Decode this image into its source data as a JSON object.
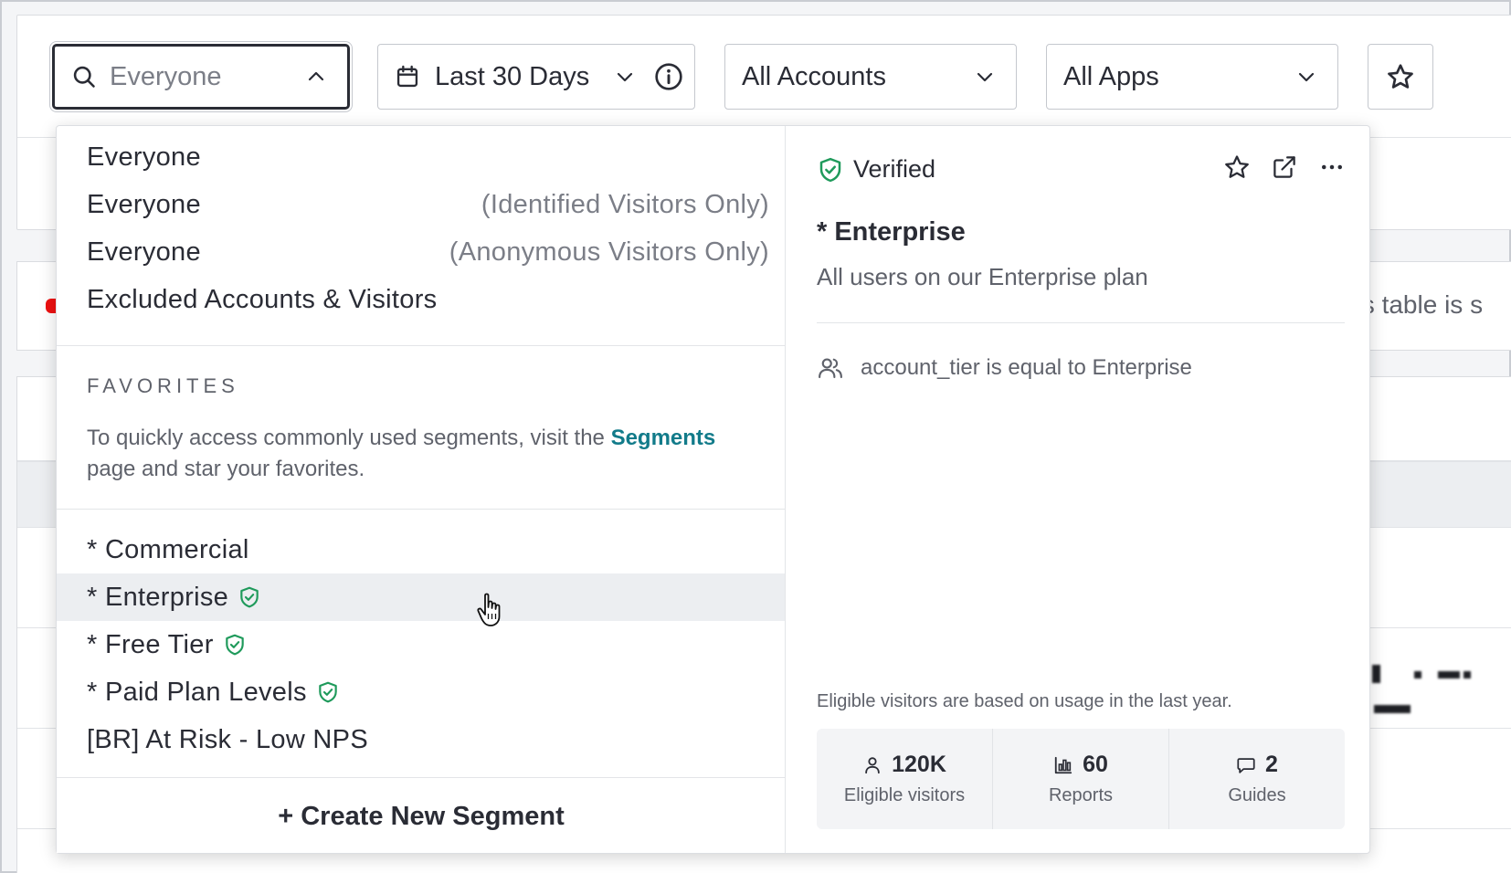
{
  "filters": {
    "segment": {
      "value": "Everyone"
    },
    "date": {
      "value": "Last 30 Days"
    },
    "accounts": {
      "value": "All Accounts"
    },
    "apps": {
      "value": "All Apps"
    }
  },
  "background": {
    "partial_text": "his table is s"
  },
  "dropdown": {
    "options": [
      {
        "label": "Everyone",
        "qualifier": ""
      },
      {
        "label": "Everyone",
        "qualifier": "(Identified Visitors Only)"
      },
      {
        "label": "Everyone",
        "qualifier": "(Anonymous Visitors Only)"
      },
      {
        "label": "Excluded Accounts & Visitors",
        "qualifier": ""
      }
    ],
    "favorites": {
      "heading": "FAVORITES",
      "text_before": "To quickly access commonly used segments, visit the ",
      "link": "Segments",
      "text_after": " page and star your favorites."
    },
    "segments": [
      {
        "label": "* Commercial",
        "verified": false
      },
      {
        "label": "* Enterprise",
        "verified": true
      },
      {
        "label": "* Free Tier",
        "verified": true
      },
      {
        "label": "* Paid Plan Levels",
        "verified": true
      },
      {
        "label": "[BR] At Risk - Low NPS",
        "verified": false
      }
    ],
    "create_label": "+ Create New Segment"
  },
  "detail": {
    "verified_label": "Verified",
    "title": "* Enterprise",
    "description": "All users on our Enterprise plan",
    "rule": "account_tier is equal to Enterprise",
    "eligibility_note": "Eligible visitors are based on usage in the last year.",
    "stats": [
      {
        "icon": "user-icon",
        "value": "120K",
        "label": "Eligible visitors"
      },
      {
        "icon": "bar-chart-icon",
        "value": "60",
        "label": "Reports"
      },
      {
        "icon": "message-icon",
        "value": "2",
        "label": "Guides"
      }
    ]
  },
  "colors": {
    "verified_green": "#1f9a5b",
    "link_teal": "#127b8a",
    "text_dark": "#2a2c35",
    "text_muted": "#5f626b"
  }
}
